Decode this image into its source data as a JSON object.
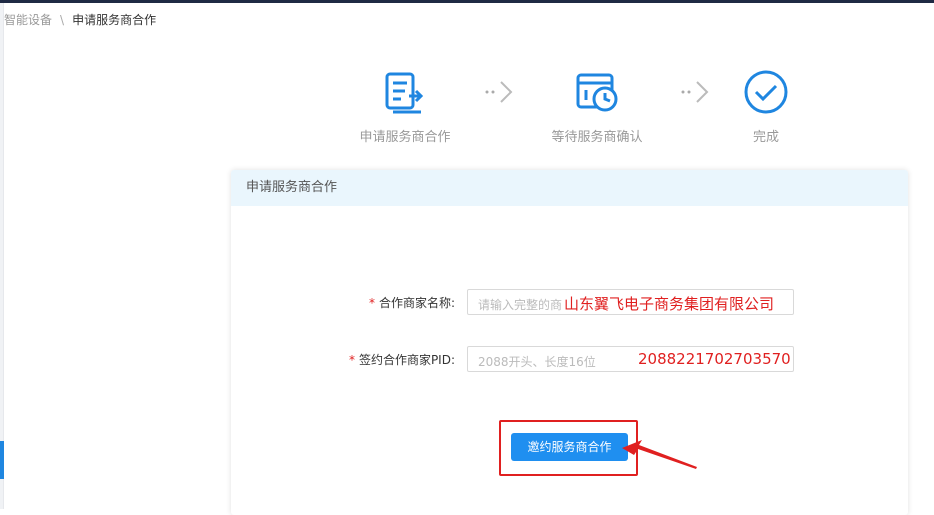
{
  "breadcrumb": {
    "parent": "智能设备",
    "separator": "\\",
    "current": "申请服务商合作"
  },
  "steps": [
    {
      "label": "申请服务商合作",
      "icon": "form-edit-icon"
    },
    {
      "label": "等待服务商确认",
      "icon": "calendar-clock-icon"
    },
    {
      "label": "完成",
      "icon": "check-circle-icon"
    }
  ],
  "panel": {
    "title": "申请服务商合作"
  },
  "form": {
    "merchant_name": {
      "label": "合作商家名称:",
      "required_mark": "*",
      "placeholder": "请输入完整的商",
      "annotation": "山东翼飞电子商务集团有限公司"
    },
    "merchant_pid": {
      "label": "签约合作商家PID:",
      "required_mark": "*",
      "placeholder": "2088开头、长度16位",
      "annotation": "2088221702703570"
    }
  },
  "submit_button": {
    "label": "邀约服务商合作"
  },
  "colors": {
    "accent": "#1f8ff0",
    "annotation": "#e02020",
    "header_bg": "#eaf6fd"
  }
}
